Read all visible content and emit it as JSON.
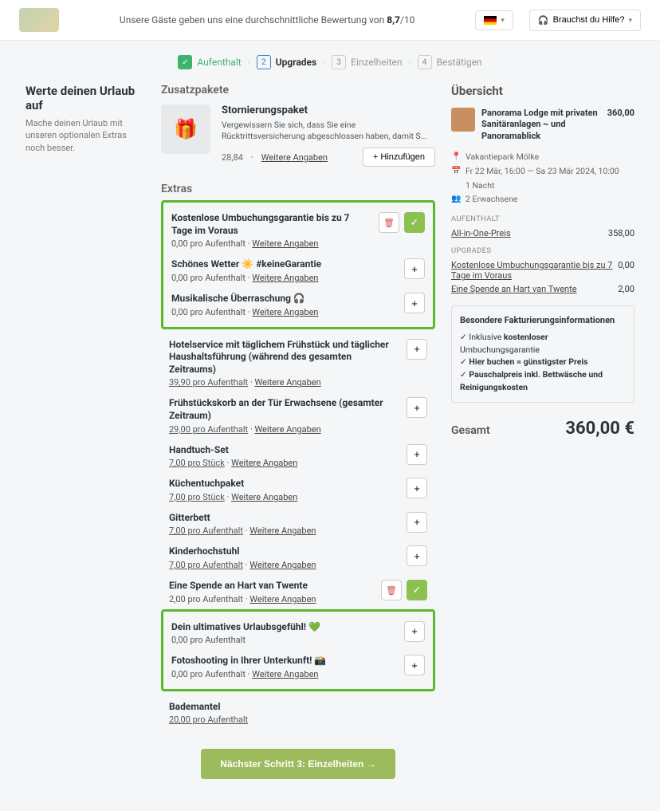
{
  "top": {
    "rating_prefix": "Unsere Gäste geben uns eine durchschnittliche Bewertung von ",
    "rating_value": "8,7",
    "rating_suffix": "/10",
    "help": "Brauchst du Hilfe?"
  },
  "steps": [
    {
      "num": "✓",
      "label": "Aufenthalt",
      "state": "done"
    },
    {
      "num": "2",
      "label": "Upgrades",
      "state": "active"
    },
    {
      "num": "3",
      "label": "Einzelheiten",
      "state": ""
    },
    {
      "num": "4",
      "label": "Bestätigen",
      "state": ""
    }
  ],
  "left": {
    "title": "Werte deinen Urlaub auf",
    "desc": "Mache deinen Urlaub mit unseren optionalen Extras noch besser."
  },
  "mid": {
    "packages_title": "Zusatzpakete",
    "package": {
      "title": "Stornierungspaket",
      "desc": "Vergewissern Sie sich, dass Sie eine Rücktrittsversicherung abgeschlossen haben, damit S...",
      "price": "28,84",
      "more": "Weitere Angaben",
      "add": "+ Hinzufügen"
    },
    "extras_title": "Extras",
    "more": "Weitere Angaben",
    "group1": [
      {
        "name": "Kostenlose Umbuchungsgarantie bis zu 7 Tage im Voraus",
        "sub": "0,00 pro Aufenthalt",
        "selected": true
      },
      {
        "name": "Schönes Wetter ☀️ #keineGarantie",
        "sub": "0,00 pro Aufenthalt",
        "selected": false
      },
      {
        "name": "Musikalische Überraschung 🎧",
        "sub": "0,00 pro Aufenthalt",
        "selected": false
      }
    ],
    "plain": [
      {
        "name": "Hotelservice mit täglichem Frühstück und täglicher Haushaltsführung (während des gesamten Zeitraums)",
        "sub": "39,90 pro Aufenthalt"
      },
      {
        "name": "Frühstückskorb an der Tür Erwachsene (gesamter Zeitraum)",
        "sub": "29,00 pro Aufenthalt"
      },
      {
        "name": "Handtuch-Set",
        "sub": "7,00 pro Stück"
      },
      {
        "name": "Küchentuchpaket",
        "sub": "7,00 pro Stück"
      },
      {
        "name": "Gitterbett",
        "sub": "7,00 pro Aufenthalt"
      },
      {
        "name": "Kinderhochstuhl",
        "sub": "7,00 pro Aufenthalt"
      }
    ],
    "donation": {
      "name": "Eine Spende an Hart van Twente",
      "sub": "2,00 pro Aufenthalt"
    },
    "group2": [
      {
        "name": "Dein ultimatives Urlaubsgefühl! 💚",
        "sub": "0,00 pro Aufenthalt",
        "nomore": true
      },
      {
        "name": "Fotoshooting in Ihrer Unterkunft! 📸",
        "sub": "0,00 pro Aufenthalt"
      }
    ],
    "last": {
      "name": "Bademantel",
      "sub": "20,00 pro Aufenthalt"
    },
    "next": "Nächster Schritt 3: Einzelheiten →"
  },
  "overview": {
    "title": "Übersicht",
    "room": "Panorama Lodge mit privaten Sanitäranlagen ~ und Panoramablick",
    "room_price": "360,00",
    "park": "Vakantiepark Mölke",
    "dates": "Fr 22 Mär, 16:00 — Sa 23 Mär 2024, 10:00",
    "nights": "1 Nacht",
    "guests": "2 Erwachsene",
    "cat_stay": "AUFENTHALT",
    "stay_line": {
      "label": "All-in-One-Preis",
      "val": "358,00"
    },
    "cat_upgrades": "UPGRADES",
    "upgrades": [
      {
        "label": "Kostenlose Umbuchungsgarantie bis zu 7 Tage im Voraus",
        "val": "0,00"
      },
      {
        "label": "Eine Spende an Hart van Twente",
        "val": "2,00"
      }
    ],
    "info_title": "Besondere Fakturierungsinformationen",
    "info_lines": [
      "Inklusive <b>kostenloser</b> Umbuchungsgarantie",
      "<b>Hier buchen = günstigster Preis</b>",
      "<b>Pauschalpreis inkl. Bettwäsche und Reinigungskosten</b>"
    ],
    "total_label": "Gesamt",
    "total_val": "360,00 €"
  }
}
